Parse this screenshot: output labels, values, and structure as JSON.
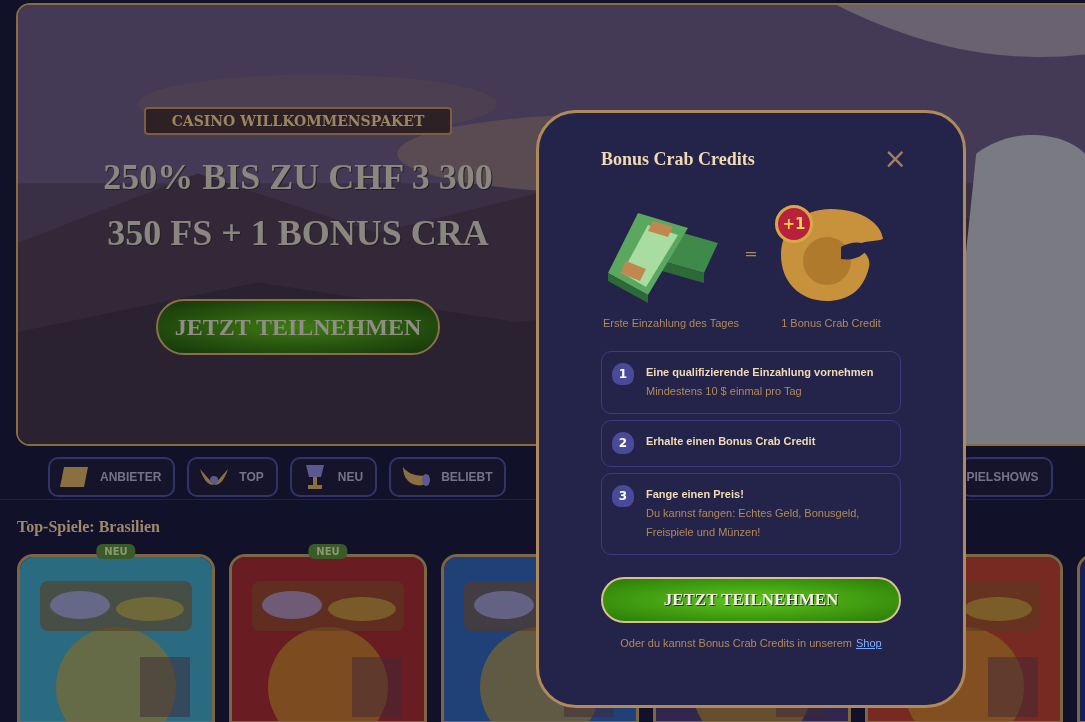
{
  "hero": {
    "badge": "CASINO WILLKOMMENSPAKET",
    "headline": [
      "250% BIS ZU CHF 3 300",
      "350 FS + 1 BONUS CRA"
    ],
    "button": "JETZT TEILNEHMEN"
  },
  "categories": [
    {
      "label": "ANBIETER"
    },
    {
      "label": "TOP"
    },
    {
      "label": "NEU"
    },
    {
      "label": "BELIEBT"
    },
    {
      "label": "PIELSHOWS"
    }
  ],
  "section_title": "Top-Spiele: Brasilien",
  "games": [
    {
      "kind": "picture",
      "badge": "NEU"
    },
    {
      "kind": "picture",
      "badge": "NEU"
    },
    {
      "kind": "picture"
    },
    {
      "kind": "picture"
    },
    {
      "kind": "picture"
    },
    {
      "kind": "picture"
    }
  ],
  "modal": {
    "title": "Bonus Crab Credits",
    "close": "×",
    "exchange": {
      "left_caption": "Erste Einzahlung des Tages",
      "equals": "=",
      "reward_badge": "+1",
      "right_caption": "1 Bonus Crab Credit"
    },
    "steps": [
      {
        "number": "1",
        "title": "Eine qualifizierende Einzahlung vornehmen",
        "detail": "Mindestens 10 $ einmal pro Tag"
      },
      {
        "number": "2",
        "title": "Erhalte einen Bonus Crab Credit"
      },
      {
        "number": "3",
        "title": "Fange einen Preis!",
        "detail": "Du kannst fangen: Echtes Geld, Bonusgeld, Freispiele und Münzen!"
      }
    ],
    "button": "JETZT TEILNEHMEN",
    "footer": {
      "text": "Oder du kannst Bonus Crab Credits in unserem",
      "link": "Shop"
    }
  }
}
